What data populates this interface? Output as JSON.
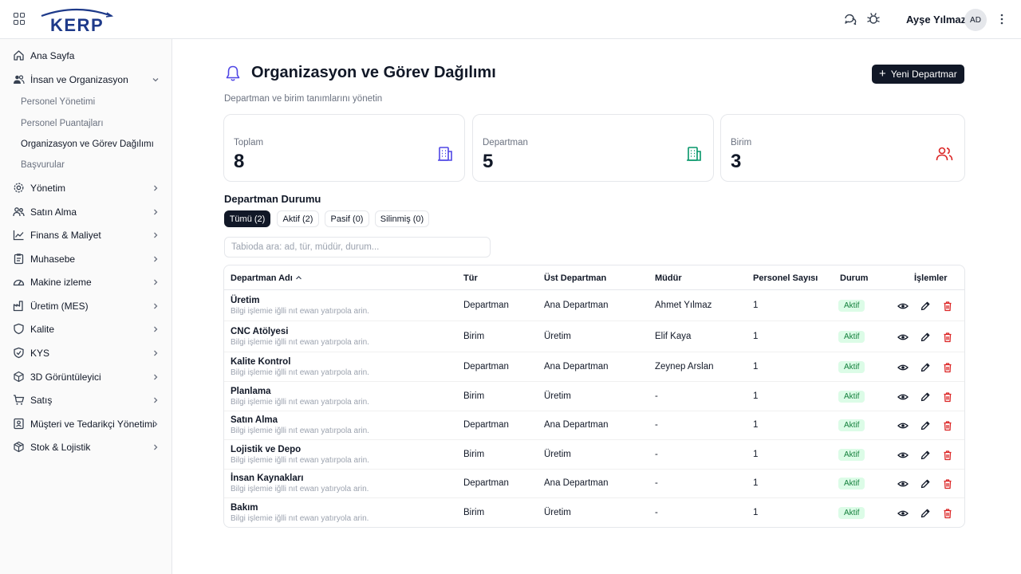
{
  "header": {
    "logo_text": "KERP",
    "user_name": "Ayşe Yılmaz",
    "avatar_initials": "AD",
    "icons": [
      "grid-icon",
      "chat-icon",
      "bug-icon",
      "kebab-icon"
    ]
  },
  "sidebar": {
    "items": [
      {
        "label": "Ana Sayfa",
        "icon": "home-icon"
      },
      {
        "label": "İnsan ve Organizasyon",
        "icon": "users-icon",
        "expanded": true
      },
      {
        "label": "Yönetim",
        "icon": "gear-icon"
      },
      {
        "label": "Satın Alma",
        "icon": "handshake-icon"
      },
      {
        "label": "Finans & Maliyet",
        "icon": "chart-icon"
      },
      {
        "label": "Muhasebe",
        "icon": "clipboard-icon"
      },
      {
        "label": "Makine izleme",
        "icon": "gauge-icon"
      },
      {
        "label": "Üretim (MES)",
        "icon": "factory-icon"
      },
      {
        "label": "Kalite",
        "icon": "shield-icon"
      },
      {
        "label": "KYS",
        "icon": "shield-check-icon"
      },
      {
        "label": "3D Görüntüleyici",
        "icon": "cube-icon"
      },
      {
        "label": "Satış",
        "icon": "cart-icon"
      },
      {
        "label": "Müşteri ve Tedarikçi Yönetimi",
        "icon": "contact-icon"
      },
      {
        "label": "Stok & Lojistik",
        "icon": "package-icon"
      }
    ],
    "sub_items": [
      {
        "label": "Personel Yönetimi",
        "active": false
      },
      {
        "label": "Personel Puantajları",
        "active": false
      },
      {
        "label": "Organizasyon ve Görev Dağılımı",
        "active": true
      },
      {
        "label": "Başvurular",
        "active": false
      }
    ]
  },
  "page": {
    "title": "Organizasyon ve Görev Dağılımı",
    "subtitle": "Departman ve birim tanımlarını yönetin",
    "new_button": "Yeni Departmar"
  },
  "stats": [
    {
      "label": "Toplam",
      "value": "8",
      "color": "#4f46e5",
      "icon": "building-icon"
    },
    {
      "label": "Departman",
      "value": "5",
      "color": "#059669",
      "icon": "building-icon"
    },
    {
      "label": "Birim",
      "value": "3",
      "color": "#dc2626",
      "icon": "users-icon"
    }
  ],
  "filters": {
    "title": "Departman Durumu",
    "tabs": [
      {
        "label": "Tümü (2)",
        "active": true
      },
      {
        "label": "Aktif (2)",
        "active": false
      },
      {
        "label": "Pasif (0)",
        "active": false
      },
      {
        "label": "Silinmiş (0)",
        "active": false
      }
    ]
  },
  "search": {
    "placeholder": "Tabioda ara: ad, tür, müdür, durum..."
  },
  "table": {
    "columns": [
      "Departman Adı",
      "Tür",
      "Üst Departman",
      "Müdür",
      "Personel Sayısı",
      "Durum",
      "İşlemler"
    ],
    "rows": [
      {
        "name": "Üretim",
        "desc": "Bilgi işlemie iğlli nıt ewan yatırpola arin.",
        "type": "Departman",
        "parent": "Ana Departman",
        "manager": "Ahmet Yılmaz",
        "count": "1",
        "status": "Aktif"
      },
      {
        "name": "CNC Atölyesi",
        "desc": "Bilgi işlemie iğlli nıt ewan yatırpola arin.",
        "type": "Birim",
        "parent": "Üretim",
        "manager": "Elif Kaya",
        "count": "1",
        "status": "Aktif"
      },
      {
        "name": "Kalite Kontrol",
        "desc": "Bilgi işlemie iğlli nıt ewan yatırpola arin.",
        "type": "Departman",
        "parent": "Ana Departman",
        "manager": "Zeynep Arslan",
        "count": "1",
        "status": "Aktif"
      },
      {
        "name": "Planlama",
        "desc": "Bilgi işlemie iğlli nıt ewan yatırpola arin.",
        "type": "Birim",
        "parent": "Üretim",
        "manager": "-",
        "count": "1",
        "status": "Aktif"
      },
      {
        "name": "Satın Alma",
        "desc": "Bilgi işlemie iğlli nıt ewan yatırpola arin.",
        "type": "Departman",
        "parent": "Ana Departman",
        "manager": "-",
        "count": "1",
        "status": "Aktif"
      },
      {
        "name": "Lojistik ve Depo",
        "desc": "Bilgi işlemie iğlli nıt ewan yatırpola arin.",
        "type": "Birim",
        "parent": "Üretim",
        "manager": "-",
        "count": "1",
        "status": "Aktif"
      },
      {
        "name": "İnsan Kaynakları",
        "desc": "Bilgi işlemie iğlli nıt ewan yatıryola arin.",
        "type": "Departman",
        "parent": "Ana Departman",
        "manager": "-",
        "count": "1",
        "status": "Aktif"
      },
      {
        "name": "Bakım",
        "desc": "Bilgi işlemie iğlli nıt ewan yatıryola arin.",
        "type": "Birim",
        "parent": "Üretim",
        "manager": "-",
        "count": "1",
        "status": "Aktif"
      }
    ]
  },
  "colors": {
    "accent": "#111827",
    "brand": "#1e3a8a",
    "success_bg": "#dcfce7",
    "success_text": "#15803d",
    "danger": "#dc2626"
  }
}
